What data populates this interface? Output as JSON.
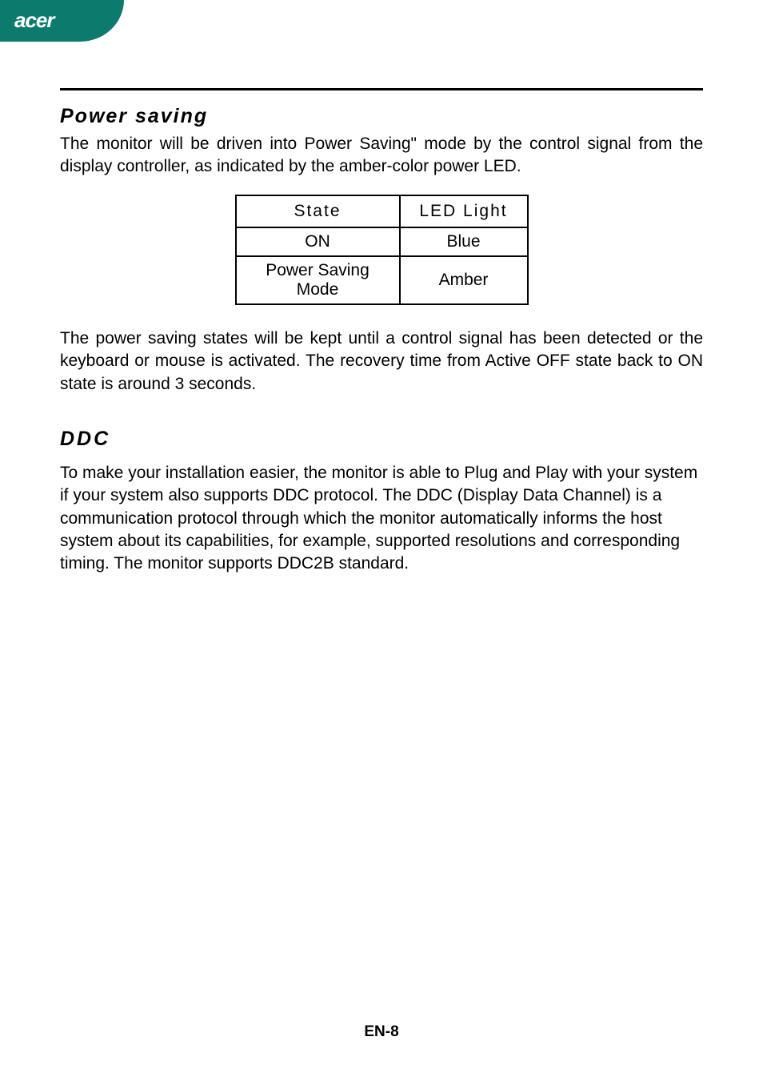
{
  "brand": "acer",
  "section1": {
    "heading": "Power saving",
    "para1": "The monitor will be driven into Power Saving\" mode by the control signal from the display controller, as indicated by the amber-color power LED.",
    "para2": "The power saving states will be kept until a control signal has been detected or the keyboard or mouse is activated. The recovery time from Active OFF state back to ON state is around 3 seconds."
  },
  "table": {
    "headers": {
      "state": "State",
      "led": "LED Light"
    },
    "rows": [
      {
        "state": "ON",
        "led": "Blue"
      },
      {
        "state": "Power Saving Mode",
        "led": "Amber"
      }
    ]
  },
  "section2": {
    "heading": "DDC",
    "para": "To make your installation easier, the monitor is able to Plug and Play with your system if your system also supports DDC protocol. The DDC (Display Data Channel) is a communication protocol through which the monitor automatically informs the host system  about its capabilities, for example, supported resolutions and corresponding timing. The monitor supports DDC2B standard."
  },
  "footer": "EN-8"
}
